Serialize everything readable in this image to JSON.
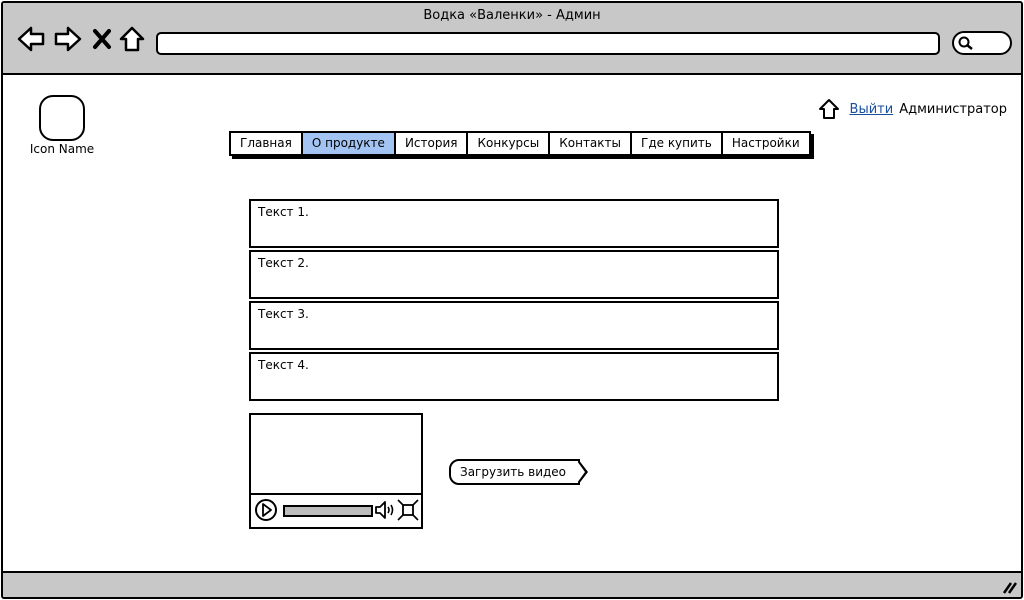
{
  "window": {
    "title": "Водка «Валенки» - Админ"
  },
  "browser": {
    "nav_icons": [
      "back-icon",
      "forward-icon",
      "close-icon",
      "home-icon"
    ],
    "address_value": "",
    "search_icon": "search-icon"
  },
  "app": {
    "icon_label": "Icon Name"
  },
  "user_bar": {
    "home_icon": "home-icon",
    "logout_label": "Выйти",
    "user_name": "Администратор"
  },
  "tabs": [
    {
      "label": "Главная",
      "active": false
    },
    {
      "label": "О продукте",
      "active": true
    },
    {
      "label": "История",
      "active": false
    },
    {
      "label": "Конкурсы",
      "active": false
    },
    {
      "label": "Контакты",
      "active": false
    },
    {
      "label": "Где купить",
      "active": false
    },
    {
      "label": "Настройки",
      "active": false
    }
  ],
  "text_fields": [
    "Текст 1.",
    "Текст 2.",
    "Текст 3.",
    "Текст 4."
  ],
  "video": {
    "icons": [
      "play-icon",
      "volume-icon",
      "fullscreen-icon"
    ]
  },
  "upload_button": {
    "label": "Загрузить видео"
  },
  "colors": {
    "chrome": "#c8c8c8",
    "active_tab": "#a3c4f3",
    "link": "#1a4fa0"
  }
}
